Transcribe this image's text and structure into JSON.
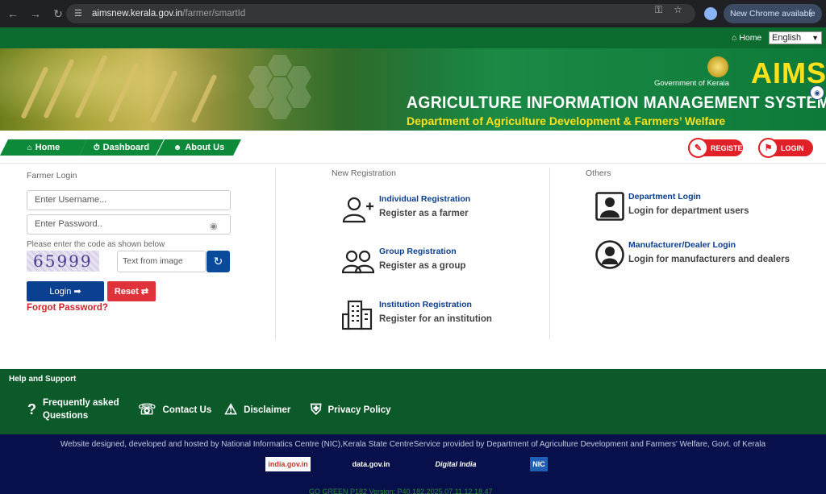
{
  "browser": {
    "url_host": "aimsnew.kerala.gov.in",
    "url_path": "/farmer/smartId",
    "update_label": "New Chrome available"
  },
  "topbar": {
    "home_label": "Home",
    "language": "English"
  },
  "banner": {
    "gov_label": "Government of Kerala",
    "logo_text": "AIMS",
    "title": "AGRICULTURE INFORMATION MANAGEMENT SYSTEM",
    "subtitle": "Department of Agriculture Development & Farmers’ Welfare"
  },
  "nav": {
    "tabs": [
      {
        "label": "Home",
        "icon": "home-icon"
      },
      {
        "label": "Dashboard",
        "icon": "dashboard-icon"
      },
      {
        "label": "About Us",
        "icon": "users-icon"
      }
    ],
    "register_label": "REGISTER",
    "login_label": "LOGIN"
  },
  "farmer_login": {
    "section_title": "Farmer Login",
    "username_placeholder": "Enter Username...",
    "password_placeholder": "Enter Password..",
    "captcha_hint": "Please enter the code as shown below",
    "captcha_code": "65999",
    "captcha_placeholder": "Text from image",
    "login_label": "Login",
    "reset_label": "Reset",
    "forgot_label": "Forgot Password?"
  },
  "new_registration": {
    "section_title": "New Registration",
    "items": [
      {
        "link": "Individual Registration",
        "desc": "Register as a farmer",
        "icon": "add-user-icon"
      },
      {
        "link": "Group Registration",
        "desc": "Register as a group",
        "icon": "group-icon"
      },
      {
        "link": "Institution Registration",
        "desc": "Register for an institution",
        "icon": "building-icon"
      }
    ]
  },
  "others": {
    "section_title": "Others",
    "items": [
      {
        "link": "Department Login",
        "desc": "Login for department users",
        "icon": "user-square-icon"
      },
      {
        "link": "Manufacturer/Dealer Login",
        "desc": "Login for manufacturers and dealers",
        "icon": "user-circle-icon"
      }
    ]
  },
  "help": {
    "title": "Help and Support",
    "items": [
      {
        "label_line1": "Frequently asked",
        "label_line2": "Questions",
        "icon": "question-icon"
      },
      {
        "label": "Contact Us",
        "icon": "phone-icon"
      },
      {
        "label": "Disclaimer",
        "icon": "warning-icon"
      },
      {
        "label": "Privacy Policy",
        "icon": "shield-check-icon"
      }
    ]
  },
  "footer": {
    "text": "Website designed, developed and hosted by National Informatics Centre (NIC),Kerala State CentreService provided by Department of Agriculture Development and Farmers' Welfare, Govt. of Kerala",
    "logos": [
      "india.gov.in",
      "data.gov.in",
      "Digital India",
      "NIC"
    ],
    "version": "GO GREEN P182 Version: P40.182.2025.07.11.12.18.47"
  },
  "colors": {
    "primary_green": "#0c8a3a",
    "dark_green": "#0c5a2a",
    "footer_navy": "#07104a",
    "link_blue": "#0b3f8f",
    "accent_red": "#e02128",
    "banner_yellow": "#ffe11b"
  }
}
